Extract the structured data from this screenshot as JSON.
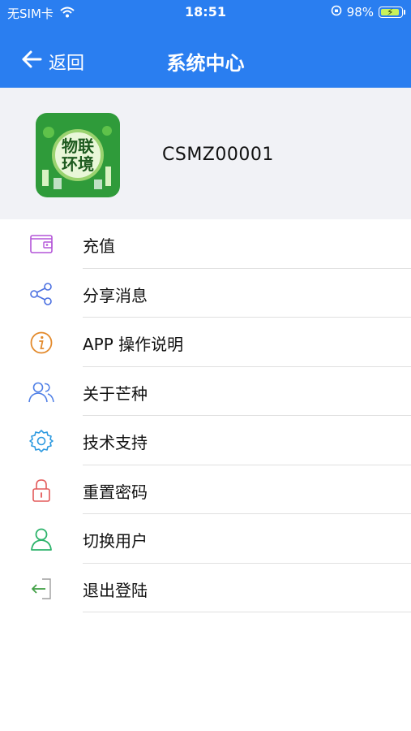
{
  "status_bar": {
    "carrier": "无SIM卡",
    "time": "18:51",
    "battery": "98%",
    "battery_level": 0.98
  },
  "nav": {
    "back_label": "返回",
    "title": "系统中心"
  },
  "profile": {
    "avatar_text_line1": "物联",
    "avatar_text_line2": "环境",
    "username": "CSMZ00001"
  },
  "menu": {
    "items": [
      {
        "label": "充值",
        "icon": "wallet-icon",
        "color": "#b455d8"
      },
      {
        "label": "分享消息",
        "icon": "share-icon",
        "color": "#4a6fe0"
      },
      {
        "label": "APP 操作说明",
        "icon": "info-icon",
        "color": "#e38a2c"
      },
      {
        "label": "关于芒种",
        "icon": "users-icon",
        "color": "#4f7fe6"
      },
      {
        "label": "技术支持",
        "icon": "gear-icon",
        "color": "#2d9ae0"
      },
      {
        "label": "重置密码",
        "icon": "lock-icon",
        "color": "#e35a5a"
      },
      {
        "label": "切换用户",
        "icon": "user-icon",
        "color": "#2db36b"
      },
      {
        "label": "退出登陆",
        "icon": "logout-icon",
        "color": "#43a047"
      }
    ]
  },
  "colors": {
    "accent": "#2a7ef0",
    "profile_bg": "#f1f2f6"
  }
}
